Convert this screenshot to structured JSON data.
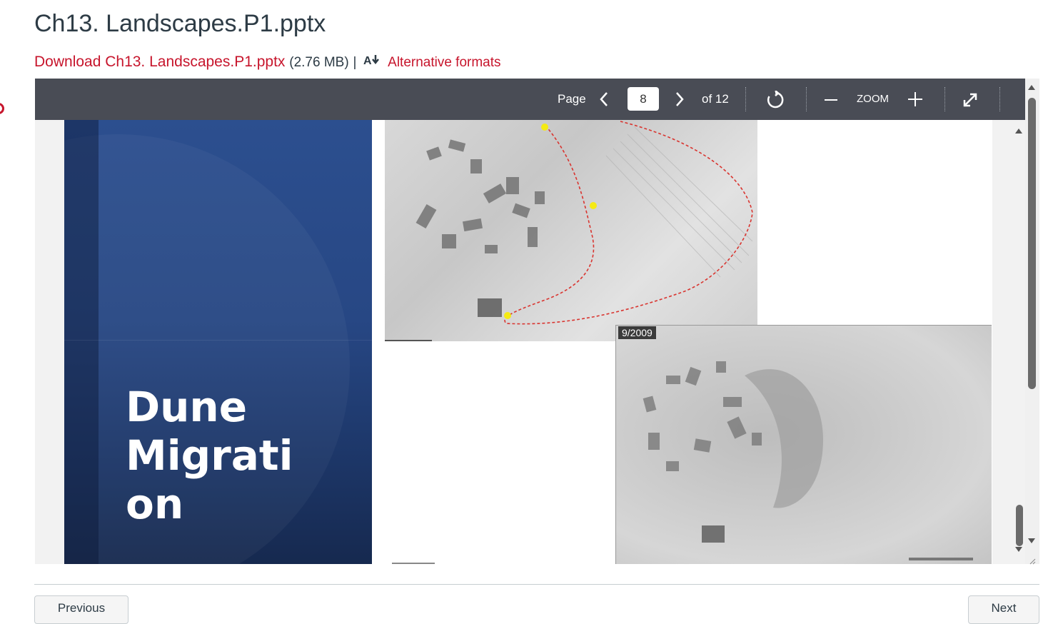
{
  "page": {
    "title": "Ch13. Landscapes.P1.pptx",
    "download_label": "Download Ch13. Landscapes.P1.pptx",
    "file_size": "(2.76 MB)",
    "separator": "|",
    "alt_formats_label": "Alternative formats"
  },
  "toolbar": {
    "page_label": "Page",
    "current_page": "8",
    "total_pages": "of 12",
    "zoom_label": "ZOOM",
    "icons": [
      "chevron-left-icon",
      "chevron-right-icon",
      "rotate-icon",
      "minus-icon",
      "plus-icon",
      "fullscreen-icon"
    ]
  },
  "slide": {
    "title": "Dune Migrati on",
    "photo_date_label": "9/2009"
  },
  "footer": {
    "previous_label": "Previous",
    "next_label": "Next"
  },
  "colors": {
    "link": "#c7152c",
    "toolbar_bg": "#494c55",
    "slide_blue": "#274784"
  }
}
